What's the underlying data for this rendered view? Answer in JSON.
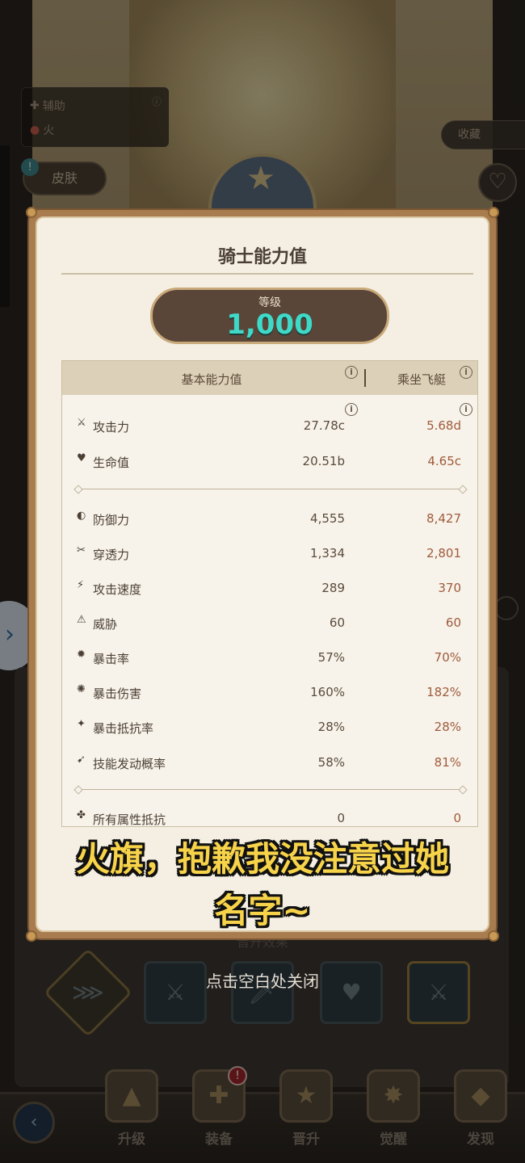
{
  "character": {
    "tags": [
      {
        "label": "辅助",
        "icon": "support-icon"
      },
      {
        "label": "火",
        "icon": "fire-icon"
      }
    ],
    "skin_label": "皮肤",
    "collect_label": "收藏"
  },
  "modal": {
    "title": "骑士能力值",
    "level_label": "等级",
    "level_value": "1,000",
    "columns": {
      "base": "基本能力值",
      "mount": "乘坐飞艇"
    },
    "stats_group1": [
      {
        "icon": "sword-icon",
        "name": "攻击力",
        "base": "27.78c",
        "mount": "5.68d"
      },
      {
        "icon": "heart-icon",
        "name": "生命值",
        "base": "20.51b",
        "mount": "4.65c"
      }
    ],
    "stats_group2": [
      {
        "icon": "shield-icon",
        "name": "防御力",
        "base": "4,555",
        "mount": "8,427"
      },
      {
        "icon": "pierce-icon",
        "name": "穿透力",
        "base": "1,334",
        "mount": "2,801"
      },
      {
        "icon": "attack-speed-icon",
        "name": "攻击速度",
        "base": "289",
        "mount": "370"
      },
      {
        "icon": "threat-icon",
        "name": "威胁",
        "base": "60",
        "mount": "60"
      },
      {
        "icon": "crit-rate-icon",
        "name": "暴击率",
        "base": "57%",
        "mount": "70%"
      },
      {
        "icon": "crit-damage-icon",
        "name": "暴击伤害",
        "base": "160%",
        "mount": "182%"
      },
      {
        "icon": "crit-resist-icon",
        "name": "暴击抵抗率",
        "base": "28%",
        "mount": "28%"
      },
      {
        "icon": "skill-proc-icon",
        "name": "技能发动概率",
        "base": "58%",
        "mount": "81%"
      }
    ],
    "stats_group3": [
      {
        "icon": "element-resist-icon",
        "name": "所有属性抵抗",
        "base": "0",
        "mount": "0"
      }
    ]
  },
  "close_hint": "点击空白处关闭",
  "promotion_title": "晋升效果",
  "subtitle": {
    "line1": "火旗，抱歉我没注意过她",
    "line2": "名字~"
  },
  "bottom_nav": [
    {
      "label": "升级",
      "icon": "upgrade-icon"
    },
    {
      "label": "装备",
      "icon": "equipment-icon",
      "badge": "!"
    },
    {
      "label": "晋升",
      "icon": "promote-icon"
    },
    {
      "label": "觉醒",
      "icon": "awaken-icon"
    },
    {
      "label": "发现",
      "icon": "discover-icon"
    }
  ]
}
